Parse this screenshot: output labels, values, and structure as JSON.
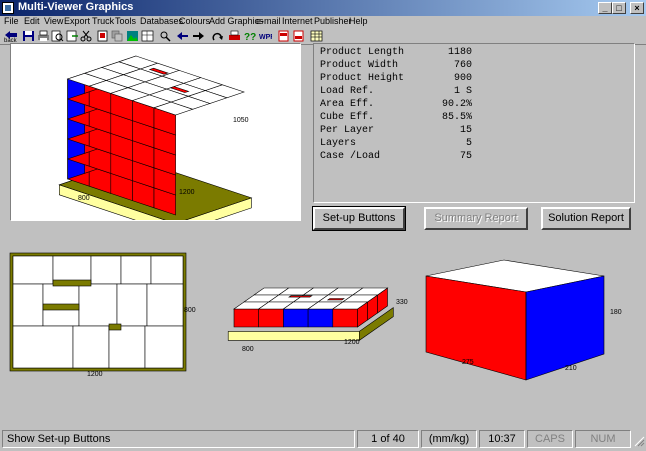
{
  "window": {
    "title": "Multi-Viewer Graphics"
  },
  "menu": [
    "File",
    "Edit",
    "View",
    "Export",
    "Truck",
    "Tools",
    "Databases",
    "Colours",
    "Add Graphics",
    "e-mail",
    "Internet",
    "Publisher",
    "Help"
  ],
  "toolbar": {
    "back_label": "back"
  },
  "colors": {
    "red": "#ff0000",
    "blue": "#0000ff",
    "pallet": "#ffffa0",
    "pallet_dark": "#7b7b00"
  },
  "views": {
    "main3d": {
      "dim_height": "1050",
      "dim_width": "800",
      "dim_length": "1200"
    },
    "plan": {
      "dim_length": "1200",
      "dim_width": "800"
    },
    "small3d": {
      "dim_height": "330",
      "dim_width": "800",
      "dim_length": "1200"
    },
    "case": {
      "dim_length": "275",
      "dim_width": "210",
      "dim_height": "180"
    }
  },
  "info": [
    {
      "label": "Product Length",
      "value": "1180"
    },
    {
      "label": "Product Width",
      "value": "760"
    },
    {
      "label": "Product Height",
      "value": "900"
    },
    {
      "label": "Load Ref.",
      "value": "1 S"
    },
    {
      "label": "Area Eff.",
      "value": "90.2%"
    },
    {
      "label": "Cube Eff.",
      "value": "85.5%"
    },
    {
      "label": "Per Layer",
      "value": "15"
    },
    {
      "label": "Layers",
      "value": "5"
    },
    {
      "label": "Case /Load",
      "value": "75"
    }
  ],
  "buttons": {
    "setup": "Set-up Buttons",
    "summary": "Summary Report",
    "solution": "Solution Report"
  },
  "status": {
    "message": "Show Set-up Buttons",
    "page": "1 of 40",
    "units": "(mm/kg)",
    "time": "10:37",
    "caps": "CAPS",
    "num": "NUM"
  }
}
